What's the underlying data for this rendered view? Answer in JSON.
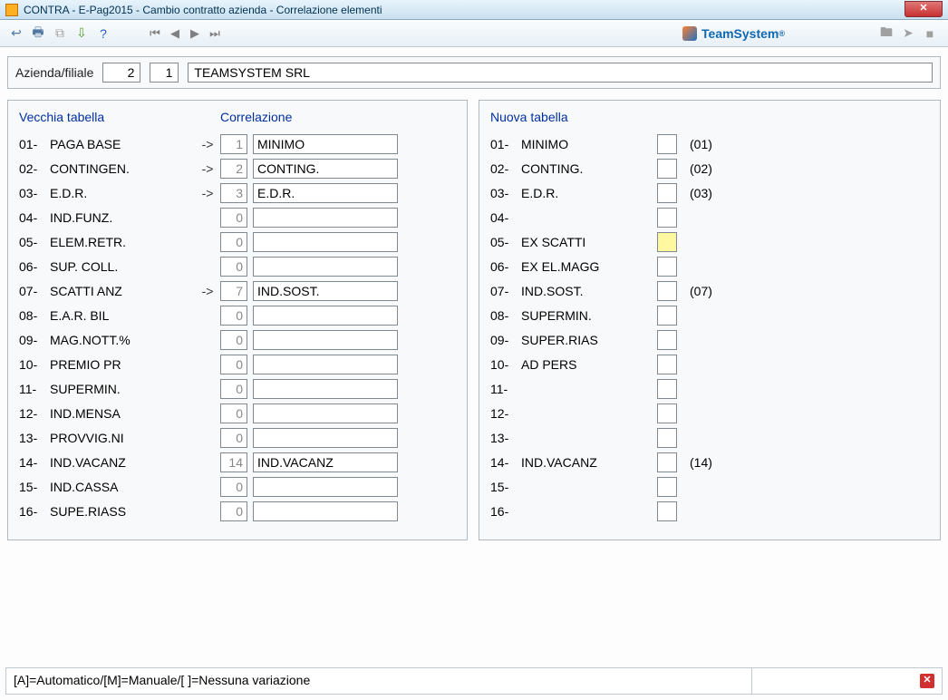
{
  "title": "CONTRA  - E-Pag2015  -  Cambio contratto azienda - Correlazione elementi",
  "brand": "TeamSystem",
  "header": {
    "azienda_label": "Azienda/filiale",
    "azienda_code": "2",
    "filiale_code": "1",
    "company_name": "TEAMSYSTEM SRL"
  },
  "left": {
    "col1": "Vecchia tabella",
    "col2": "Correlazione",
    "rows": [
      {
        "n": "01-",
        "label": "PAGA BASE",
        "arrow": "->",
        "num": "1",
        "corr": "MINIMO"
      },
      {
        "n": "02-",
        "label": "CONTINGEN.",
        "arrow": "->",
        "num": "2",
        "corr": "CONTING."
      },
      {
        "n": "03-",
        "label": "E.D.R.",
        "arrow": "->",
        "num": "3",
        "corr": "E.D.R."
      },
      {
        "n": "04-",
        "label": "IND.FUNZ.",
        "arrow": "",
        "num": "0",
        "corr": ""
      },
      {
        "n": "05-",
        "label": "ELEM.RETR.",
        "arrow": "",
        "num": "0",
        "corr": ""
      },
      {
        "n": "06-",
        "label": "SUP. COLL.",
        "arrow": "",
        "num": "0",
        "corr": ""
      },
      {
        "n": "07-",
        "label": "SCATTI ANZ",
        "arrow": "->",
        "num": "7",
        "corr": "IND.SOST."
      },
      {
        "n": "08-",
        "label": "E.A.R. BIL",
        "arrow": "",
        "num": "0",
        "corr": ""
      },
      {
        "n": "09-",
        "label": "MAG.NOTT.%",
        "arrow": "",
        "num": "0",
        "corr": ""
      },
      {
        "n": "10-",
        "label": "PREMIO PR",
        "arrow": "",
        "num": "0",
        "corr": ""
      },
      {
        "n": "11-",
        "label": "SUPERMIN.",
        "arrow": "",
        "num": "0",
        "corr": ""
      },
      {
        "n": "12-",
        "label": "IND.MENSA",
        "arrow": "",
        "num": "0",
        "corr": ""
      },
      {
        "n": "13-",
        "label": "PROVVIG.NI",
        "arrow": "",
        "num": "0",
        "corr": ""
      },
      {
        "n": "14-",
        "label": "IND.VACANZ",
        "arrow": "",
        "num": "14",
        "corr": "IND.VACANZ"
      },
      {
        "n": "15-",
        "label": "IND.CASSA",
        "arrow": "",
        "num": "0",
        "corr": ""
      },
      {
        "n": "16-",
        "label": "SUPE.RIASS",
        "arrow": "",
        "num": "0",
        "corr": ""
      }
    ]
  },
  "right": {
    "header": "Nuova tabella",
    "rows": [
      {
        "n": "01-",
        "label": "MINIMO",
        "hl": false,
        "paren": "(01)"
      },
      {
        "n": "02-",
        "label": "CONTING.",
        "hl": false,
        "paren": "(02)"
      },
      {
        "n": "03-",
        "label": "E.D.R.",
        "hl": false,
        "paren": "(03)"
      },
      {
        "n": "04-",
        "label": "",
        "hl": false,
        "paren": ""
      },
      {
        "n": "05-",
        "label": "EX SCATTI",
        "hl": true,
        "paren": ""
      },
      {
        "n": "06-",
        "label": "EX EL.MAGG",
        "hl": false,
        "paren": ""
      },
      {
        "n": "07-",
        "label": "IND.SOST.",
        "hl": false,
        "paren": "(07)"
      },
      {
        "n": "08-",
        "label": "SUPERMIN.",
        "hl": false,
        "paren": ""
      },
      {
        "n": "09-",
        "label": "SUPER.RIAS",
        "hl": false,
        "paren": ""
      },
      {
        "n": "10-",
        "label": "AD PERS",
        "hl": false,
        "paren": ""
      },
      {
        "n": "11-",
        "label": "",
        "hl": false,
        "paren": ""
      },
      {
        "n": "12-",
        "label": "",
        "hl": false,
        "paren": ""
      },
      {
        "n": "13-",
        "label": "",
        "hl": false,
        "paren": ""
      },
      {
        "n": "14-",
        "label": "IND.VACANZ",
        "hl": false,
        "paren": "(14)"
      },
      {
        "n": "15-",
        "label": "",
        "hl": false,
        "paren": ""
      },
      {
        "n": "16-",
        "label": "",
        "hl": false,
        "paren": ""
      }
    ]
  },
  "status": "[A]=Automatico/[M]=Manuale/[ ]=Nessuna variazione"
}
